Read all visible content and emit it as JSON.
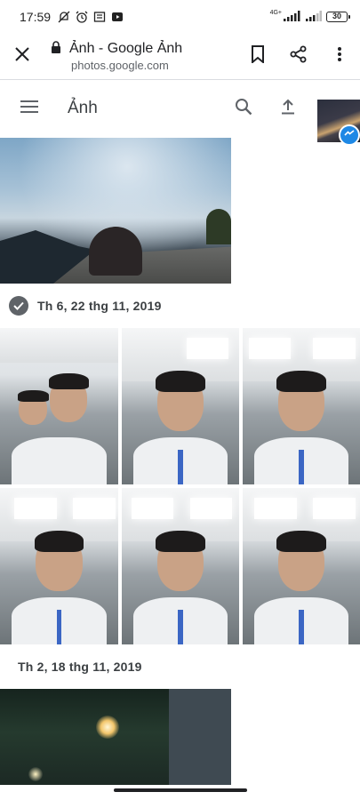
{
  "status_bar": {
    "time": "17:59",
    "network_label": "4G+",
    "battery": "30"
  },
  "browser": {
    "page_title": "Ảnh - Google Ảnh",
    "url_host": "photos.google.com"
  },
  "app": {
    "title": "Ảnh"
  },
  "sections": [
    {
      "date": "Th 6, 22 thg 11, 2019"
    },
    {
      "date": "Th 2, 18 thg 11, 2019"
    }
  ],
  "colors": {
    "accent_icon": "#5f6368",
    "text_primary": "#202124",
    "messenger_blue": "#1e88e5"
  }
}
